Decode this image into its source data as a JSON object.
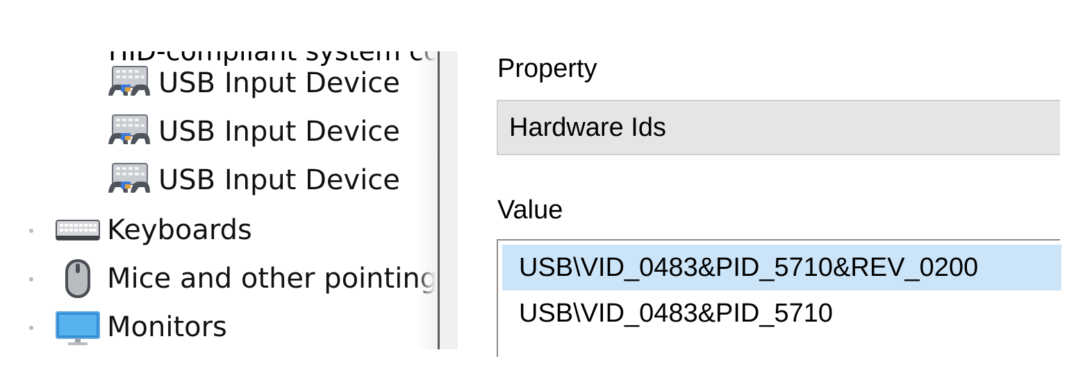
{
  "tree": {
    "cut_item_label": "HID-compliant system controller",
    "children": [
      {
        "label": "USB Input Device",
        "icon": "hid-device-icon"
      },
      {
        "label": "USB Input Device",
        "icon": "hid-device-icon"
      },
      {
        "label": "USB Input Device",
        "icon": "hid-device-icon"
      }
    ],
    "categories": [
      {
        "label": "Keyboards",
        "icon": "keyboard-icon"
      },
      {
        "label": "Mice and other pointing devices",
        "icon": "mouse-icon"
      },
      {
        "label": "Monitors",
        "icon": "monitor-icon"
      }
    ]
  },
  "properties": {
    "property_label": "Property",
    "property_value": "Hardware Ids",
    "value_label": "Value",
    "values": [
      "USB\\VID_0483&PID_5710&REV_0200",
      "USB\\VID_0483&PID_5710"
    ],
    "selected_index": 0
  },
  "colors": {
    "selection": "#cce4f7",
    "combo_bg": "#e5e5e5",
    "divider": "#5a5a5a"
  }
}
